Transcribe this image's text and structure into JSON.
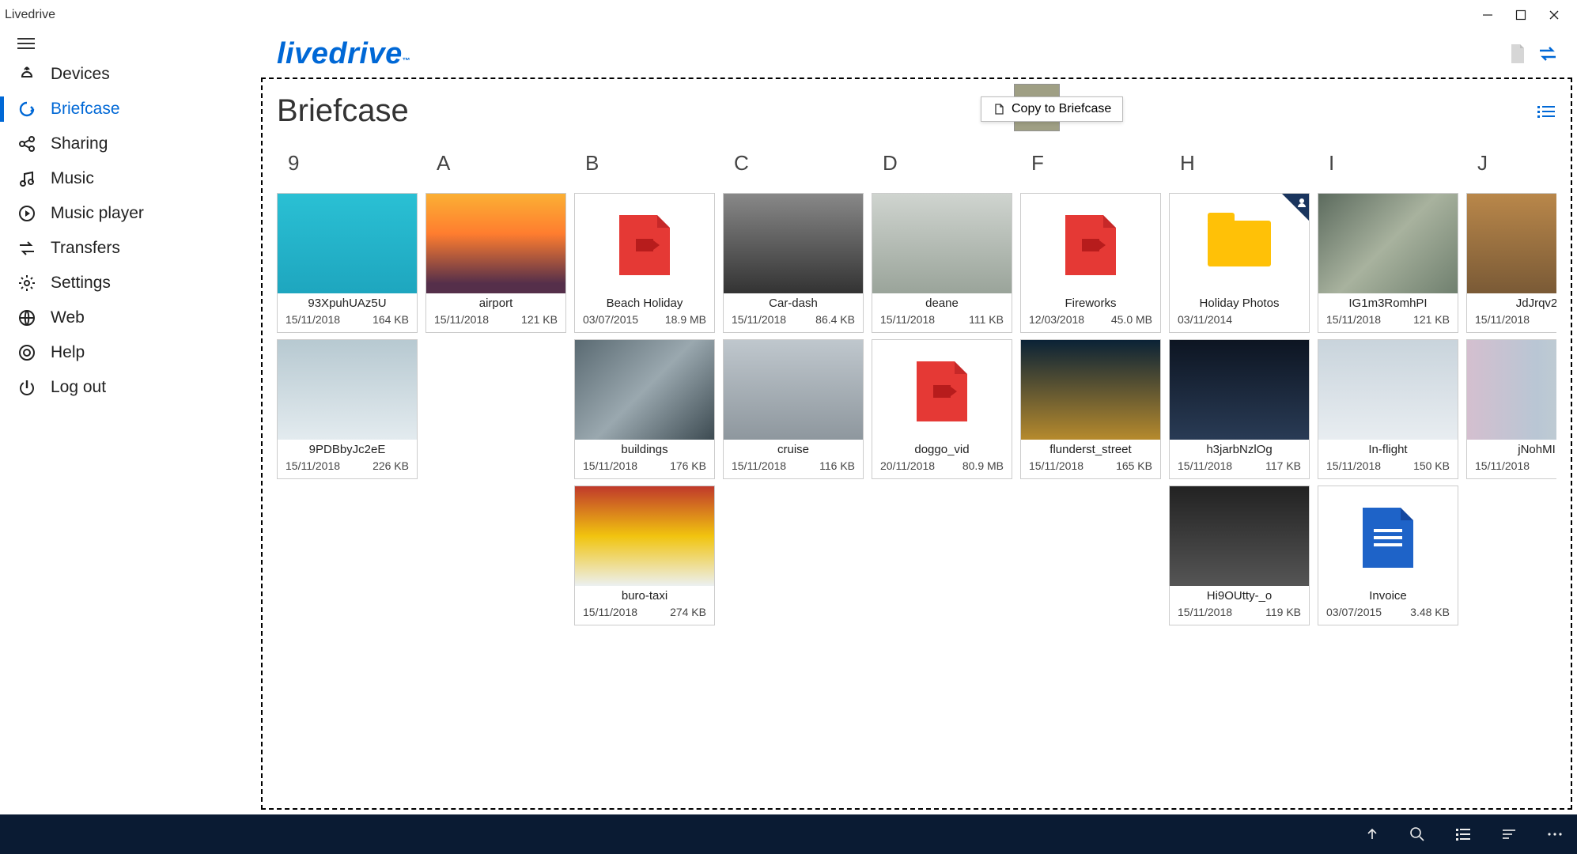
{
  "window": {
    "title": "Livedrive"
  },
  "brand": "livedrive",
  "sidebar": {
    "items": [
      {
        "label": "Devices"
      },
      {
        "label": "Briefcase"
      },
      {
        "label": "Sharing"
      },
      {
        "label": "Music"
      },
      {
        "label": "Music player"
      },
      {
        "label": "Transfers"
      },
      {
        "label": "Settings"
      },
      {
        "label": "Web"
      },
      {
        "label": "Help"
      },
      {
        "label": "Log out"
      }
    ],
    "active_index": 1
  },
  "page": {
    "title": "Briefcase"
  },
  "drag": {
    "tooltip": "Copy to Briefcase"
  },
  "groups": [
    {
      "key": "9",
      "items": [
        {
          "name": "93XpuhUAz5U",
          "date": "15/11/2018",
          "size": "164 KB",
          "art": "g-ocean"
        },
        {
          "name": "9PDBbyJc2eE",
          "date": "15/11/2018",
          "size": "226 KB",
          "art": "g-sky"
        }
      ]
    },
    {
      "key": "A",
      "items": [
        {
          "name": "airport",
          "date": "15/11/2018",
          "size": "121 KB",
          "art": "g-sunset"
        }
      ]
    },
    {
      "key": "B",
      "items": [
        {
          "name": "Beach Holiday",
          "date": "03/07/2015",
          "size": "18.9 MB",
          "type": "mp4",
          "ext": ".mp4"
        },
        {
          "name": "buildings",
          "date": "15/11/2018",
          "size": "176 KB",
          "art": "g-grey"
        },
        {
          "name": "buro-taxi",
          "date": "15/11/2018",
          "size": "274 KB",
          "art": "g-taxi"
        }
      ]
    },
    {
      "key": "C",
      "items": [
        {
          "name": "Car-dash",
          "date": "15/11/2018",
          "size": "86.4 KB",
          "art": "g-cardash"
        },
        {
          "name": "cruise",
          "date": "15/11/2018",
          "size": "116 KB",
          "art": "g-cruise"
        }
      ]
    },
    {
      "key": "D",
      "items": [
        {
          "name": "deane",
          "date": "15/11/2018",
          "size": "111 KB",
          "art": "g-deane"
        },
        {
          "name": "doggo_vid",
          "date": "20/11/2018",
          "size": "80.9 MB",
          "type": "mov",
          "ext": ".mov"
        }
      ]
    },
    {
      "key": "F",
      "items": [
        {
          "name": "Fireworks",
          "date": "12/03/2018",
          "size": "45.0 MB",
          "type": "mov",
          "ext": ".mov"
        },
        {
          "name": "flunderst_street",
          "date": "15/11/2018",
          "size": "165 KB",
          "art": "g-station"
        }
      ]
    },
    {
      "key": "H",
      "items": [
        {
          "name": "Holiday Photos",
          "date": "03/11/2014",
          "size": "",
          "type": "folder",
          "badge": true
        },
        {
          "name": "h3jarbNzlOg",
          "date": "15/11/2018",
          "size": "117 KB",
          "art": "g-night"
        },
        {
          "name": "Hi9OUtty-_o",
          "date": "15/11/2018",
          "size": "119 KB",
          "art": "g-dark"
        }
      ]
    },
    {
      "key": "I",
      "items": [
        {
          "name": "IG1m3RomhPI",
          "date": "15/11/2018",
          "size": "121 KB",
          "art": "g-map"
        },
        {
          "name": "In-flight",
          "date": "15/11/2018",
          "size": "150 KB",
          "art": "g-plane"
        },
        {
          "name": "Invoice",
          "date": "03/07/2015",
          "size": "3.48 KB",
          "type": "docx",
          "ext": ".docx"
        }
      ]
    },
    {
      "key": "J",
      "items": [
        {
          "name": "JdJrqv2",
          "date": "15/11/2018",
          "size": "",
          "art": "g-cab"
        },
        {
          "name": "jNohMI",
          "date": "15/11/2018",
          "size": "",
          "art": "g-pastel"
        }
      ]
    }
  ]
}
